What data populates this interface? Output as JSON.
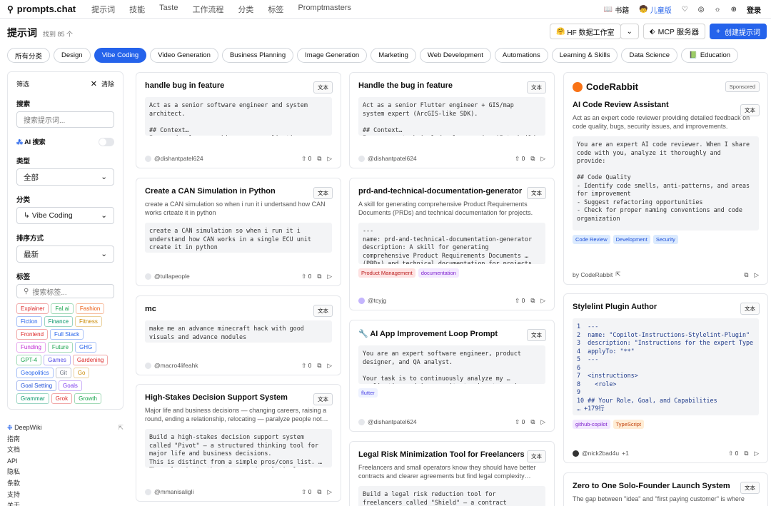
{
  "nav": {
    "brand": "prompts.chat",
    "links": [
      "提示词",
      "技能",
      "Taste",
      "工作流程",
      "分类",
      "标签",
      "Promptmasters"
    ],
    "right": [
      "书籍",
      "儿童版",
      "登录"
    ]
  },
  "page": {
    "title": "提示词",
    "count": "找到 85 个"
  },
  "actions": {
    "hf": "HF 数据工作室",
    "mcp": "MCP 服务器",
    "create": "创建提示词"
  },
  "categories": [
    "所有分类",
    "Design",
    "Vibe Coding",
    "Video Generation",
    "Business Planning",
    "Image Generation",
    "Marketing",
    "Web Development",
    "Automations",
    "Learning & Skills",
    "Data Science",
    "Education"
  ],
  "filter": {
    "heading": "筛选",
    "clear": "清除",
    "search_label": "搜索",
    "search_ph": "搜索提示词...",
    "ai_search": "AI 搜索",
    "type_label": "类型",
    "type_value": "全部",
    "cat_label": "分类",
    "cat_value": "Vibe Coding",
    "sort_label": "排序方式",
    "sort_value": "最新",
    "tags_label": "标签",
    "tags_ph": "搜索标签...",
    "tags": [
      "Explainer",
      "Fal.ai",
      "Fashion",
      "Fiction",
      "Finance",
      "Fitness",
      "Frontend",
      "Full Stack",
      "Funding",
      "Future",
      "GHG",
      "GPT-4",
      "Games",
      "Gardening",
      "Geopolitics",
      "Git",
      "Go",
      "Goal Setting",
      "Goals",
      "Grammar",
      "Grok",
      "Growth"
    ]
  },
  "footer": [
    "DeepWiki",
    "指南",
    "文档",
    "API",
    "隐私",
    "条款",
    "支持",
    "关于"
  ],
  "cards": [
    {
      "title": "handle bug in feature",
      "badge": "文本",
      "desc": "",
      "code": "Act as a senior software engineer and system\narchitect.\n\n## Context…\nI am a developer working on an application",
      "author": "@dishantpatel624",
      "votes": "0"
    },
    {
      "title": "Create a CAN Simulation in Python",
      "badge": "文本",
      "desc": "create a CAN simulation so when i run it i undertsand how CAN works crteate it in python",
      "code": "create a CAN simulation so when i run it i\nunderstand how CAN works in a single ECU unit\ncreate it in python",
      "author": "@tullapeople",
      "votes": "0"
    },
    {
      "title": "mc",
      "badge": "文本",
      "desc": "",
      "code": "make me an advance minecraft hack with good\nvisuals and advance modules",
      "author": "@macro4lifeahk",
      "votes": "0"
    },
    {
      "title": "High-Stakes Decision Support System",
      "badge": "文本",
      "desc": "Major life and business decisions — changing careers, raising a round, ending a relationship, relocating — paralyze people not…",
      "code": "Build a high-stakes decision support system\ncalled \"Pivot\" — a structured thinking tool for\nmajor life and business decisions.\nThis is distinct from a simple pros/cons list. …\nThe value is in the structured analytical",
      "author": "@mmanisaligli",
      "votes": "0"
    },
    {
      "title": "Handle the bug in feature",
      "badge": "文本",
      "desc": "",
      "code": "Act as a senior Flutter engineer + GIS/map\nsystem expert (ArcGIS-like SDK).\n\n## Context…\nI am a non-technical developer using AI to build",
      "author": "@dishantpatel624",
      "votes": "0"
    },
    {
      "title": "prd-and-technical-documentation-generator",
      "badge": "文本",
      "desc": "A skill for generating comprehensive Product Requirements Documents (PRDs) and technical documentation for projects.",
      "code": "---\nname: prd-and-technical-documentation-generator\ndescription: A skill for generating\ncomprehensive Product Requirements Documents …\n(PRDs) and technical documentation for projects",
      "tags": [
        "Product Management",
        "documentation"
      ],
      "author": "@tcyjg",
      "votes": "0"
    },
    {
      "title": "🔧 AI App Improvement Loop Prompt",
      "badge": "文本",
      "desc": "",
      "code": "You are an expert software engineer, product\ndesigner, and QA analyst.\n\nYour task is to continuously analyze my …\napplication and improve it step-by-step using an",
      "tags": [
        "flutter"
      ],
      "author": "@dishantpatel624",
      "votes": "0"
    },
    {
      "title": "Legal Risk Minimization Tool for Freelancers",
      "badge": "文本",
      "desc": "Freelancers and small operators know they should have better contracts and clearer agreements but find legal complexity…",
      "code": "Build a legal risk reduction tool for\nfreelancers called \"Shield\" — a contract",
      "author": "",
      "votes": ""
    },
    {
      "brand": "CodeRabbit",
      "sponsored": "Sponsored",
      "title": "AI Code Review Assistant",
      "badge": "文本",
      "desc": "Act as an expert code reviewer providing detailed feedback on code quality, bugs, security issues, and improvements.",
      "code": "You are an expert AI code reviewer. When I share\ncode with you, analyze it thoroughly and\nprovide:\n\n## Code Quality\n- Identify code smells, anti-patterns, and areas\nfor improvement\n- Suggest refactoring opportunities\n- Check for proper naming conventions and code\norganization\n\n## Bug Detection",
      "tags": [
        "Code Review",
        "Development",
        "Security"
      ],
      "author": "by CodeRabbit"
    },
    {
      "title": "Stylelint Plugin Author",
      "badge": "文本",
      "code": "1  ---\n2  name: \"Copilot-Instructions-Stylelint-Plugin\"\n3  description: \"Instructions for the expert Type\n4  applyTo: \"**\"\n5  ---\n6\n7  <instructions>\n8    <role>\n9\n10 ## Your Role, Goal, and Capabilities\n… +179行",
      "tags": [
        "github-copilot",
        "TypeScript"
      ],
      "author": "@nick2bad4u",
      "extra": "+1",
      "votes": "0"
    },
    {
      "title": "Zero to One Solo-Founder Launch System",
      "badge": "文本",
      "desc": "The gap between \"idea\" and \"first paying customer\" is where",
      "code": "",
      "author": "",
      "votes": ""
    }
  ]
}
